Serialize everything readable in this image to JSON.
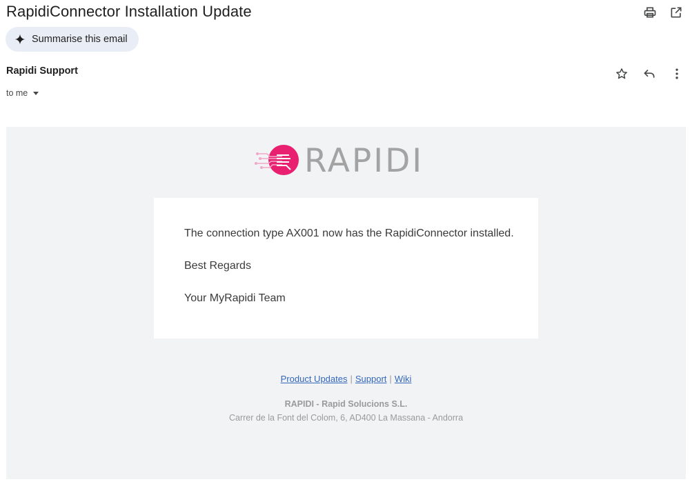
{
  "email": {
    "subject": "RapidiConnector Installation Update",
    "summarise_label": "Summarise this email",
    "sender": "Rapidi Support",
    "recipient": "to me"
  },
  "icons": {
    "print": "print-icon",
    "open_new_window": "open-in-new-window-icon",
    "star": "star-icon",
    "reply": "reply-icon",
    "more": "more-vert-icon",
    "sparkle": "sparkle-icon",
    "dropdown": "chevron-down-icon"
  },
  "body": {
    "logo_text": "RAPIDI",
    "message": "The connection type AX001 now has the RapidiConnector installed.",
    "regards": "Best Regards",
    "signature": "Your MyRapidi Team",
    "links": {
      "product_updates": "Product Updates",
      "support": "Support",
      "wiki": "Wiki",
      "separator": "|"
    },
    "company": "RAPIDI - Rapid Solucions S.L.",
    "address": "Carrer de la Font del Colom, 6, AD400 La Massana - Andorra"
  },
  "colors": {
    "brand_pink": "#e8206f",
    "logo_gray": "#a3a3a3",
    "body_bg": "#f2f3f5",
    "chip_bg": "#e9eef6",
    "link": "#3366bb"
  }
}
